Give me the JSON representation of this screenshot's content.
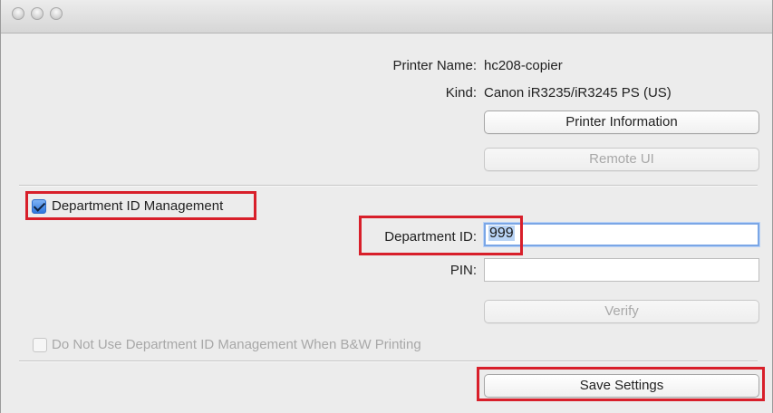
{
  "printer": {
    "name_label": "Printer Name:",
    "name_value": "hc208-copier",
    "kind_label": "Kind:",
    "kind_value": "Canon iR3235/iR3245 PS (US)"
  },
  "buttons": {
    "printer_information": "Printer Information",
    "remote_ui": "Remote UI",
    "verify": "Verify",
    "save_settings": "Save Settings"
  },
  "department": {
    "management_label": "Department ID Management",
    "id_label": "Department ID:",
    "id_value": "999",
    "pin_label": "PIN:",
    "pin_value": "",
    "bw_label": "Do Not Use Department ID Management When B&W Printing"
  },
  "colors": {
    "highlight_border": "#d81f2a",
    "checkbox_checked": "#2e78df",
    "disabled_text": "#a8a8a8"
  },
  "icons": [
    "window-close-icon",
    "window-minimize-icon",
    "window-zoom-icon",
    "checkbox-checked-icon",
    "checkbox-disabled-icon"
  ]
}
